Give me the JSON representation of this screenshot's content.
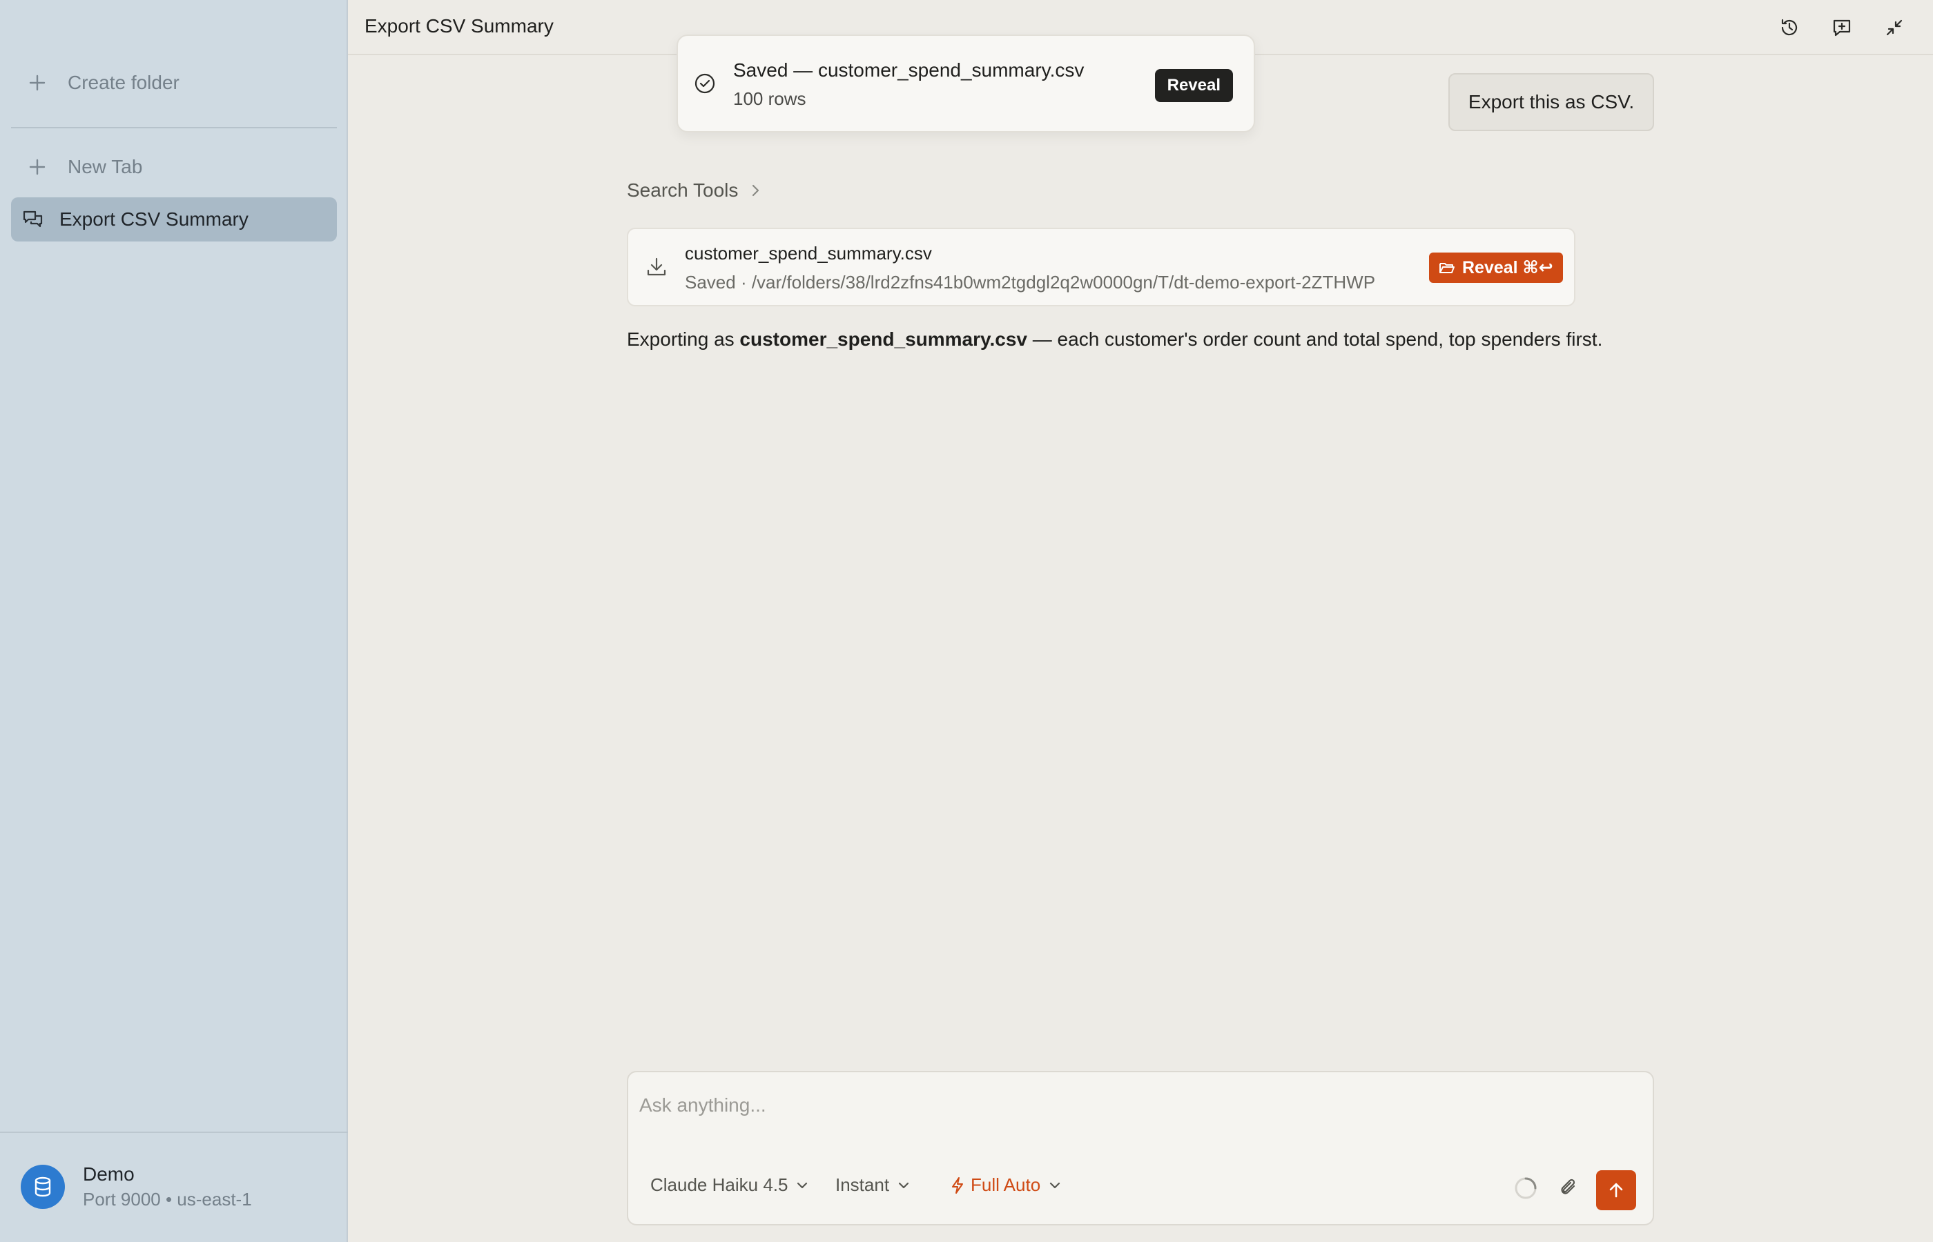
{
  "colors": {
    "accent": "#cf4a14",
    "sidebar_bg": "#cfdae2",
    "sidebar_active": "#a9bac7",
    "main_bg": "#edebe6",
    "avatar": "#2d7bd0"
  },
  "sidebar": {
    "create_folder_label": "Create folder",
    "new_tab_label": "New Tab",
    "items": [
      {
        "label": "Export CSV Summary",
        "icon": "chat-bubbles-icon",
        "active": true
      }
    ],
    "profile": {
      "name": "Demo",
      "detail": "Port 9000 • us-east-1",
      "icon": "database-icon"
    }
  },
  "header": {
    "title": "Export CSV Summary",
    "icons": [
      "history-icon",
      "new-chat-icon",
      "collapse-icon"
    ]
  },
  "toast": {
    "title": "Saved — customer_spend_summary.csv",
    "subtitle": "100 rows",
    "button_label": "Reveal"
  },
  "conversation": {
    "user_message": "Export this as CSV.",
    "search_tools_label": "Search Tools",
    "file_card": {
      "filename": "customer_spend_summary.csv",
      "path": "Saved · /var/folders/38/lrd2zfns41b0wm2tgdgl2q2w0000gn/T/dt-demo-export-2ZTHWP",
      "button_label": "Reveal ⌘↩"
    },
    "assistant": {
      "prefix": "Exporting as ",
      "filename": "customer_spend_summary.csv",
      "suffix": " — each customer's order count and total spend, top spenders first."
    }
  },
  "composer": {
    "placeholder": "Ask anything...",
    "value": "",
    "model": "Claude Haiku 4.5",
    "speed": "Instant",
    "mode": "Full Auto"
  }
}
